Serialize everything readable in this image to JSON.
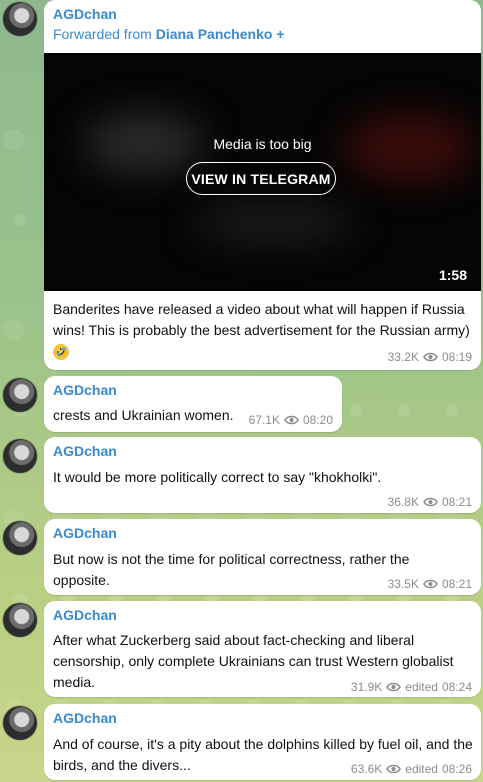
{
  "channel": {
    "name": "AGDchan",
    "link_color": "#3a8ad0"
  },
  "messages": [
    {
      "sender": "AGDchan",
      "forwarded_label": "Forwarded from",
      "forwarded_from": "Diana Panchenko +",
      "media": {
        "notice": "Media is too big",
        "button_label": "VIEW IN TELEGRAM",
        "duration": "1:58"
      },
      "text": "Banderites have released a video about what will happen if Russia wins! This is probably the best advertisement for the Russian army)",
      "emoji": "🤣",
      "views": "33.2K",
      "time": "08:19"
    },
    {
      "sender": "AGDchan",
      "text": "crests and Ukrainian women.",
      "views": "67.1K",
      "time": "08:20"
    },
    {
      "sender": "AGDchan",
      "text": "It would be more politically correct to say \"khokholki\".",
      "views": "36.8K",
      "time": "08:21"
    },
    {
      "sender": "AGDchan",
      "text": "But now is not the time for political correctness, rather the opposite.",
      "views": "33.5K",
      "time": "08:21"
    },
    {
      "sender": "AGDchan",
      "text": "After what Zuckerberg said about fact-checking and liberal censorship, only complete Ukrainians can trust Western globalist media.",
      "views": "31.9K",
      "edited": "edited",
      "time": "08:24"
    },
    {
      "sender": "AGDchan",
      "text": "And of course, it's a pity about the dolphins killed by fuel oil, and the birds, and the divers...",
      "views": "63.6K",
      "edited": "edited",
      "time": "08:26"
    }
  ]
}
